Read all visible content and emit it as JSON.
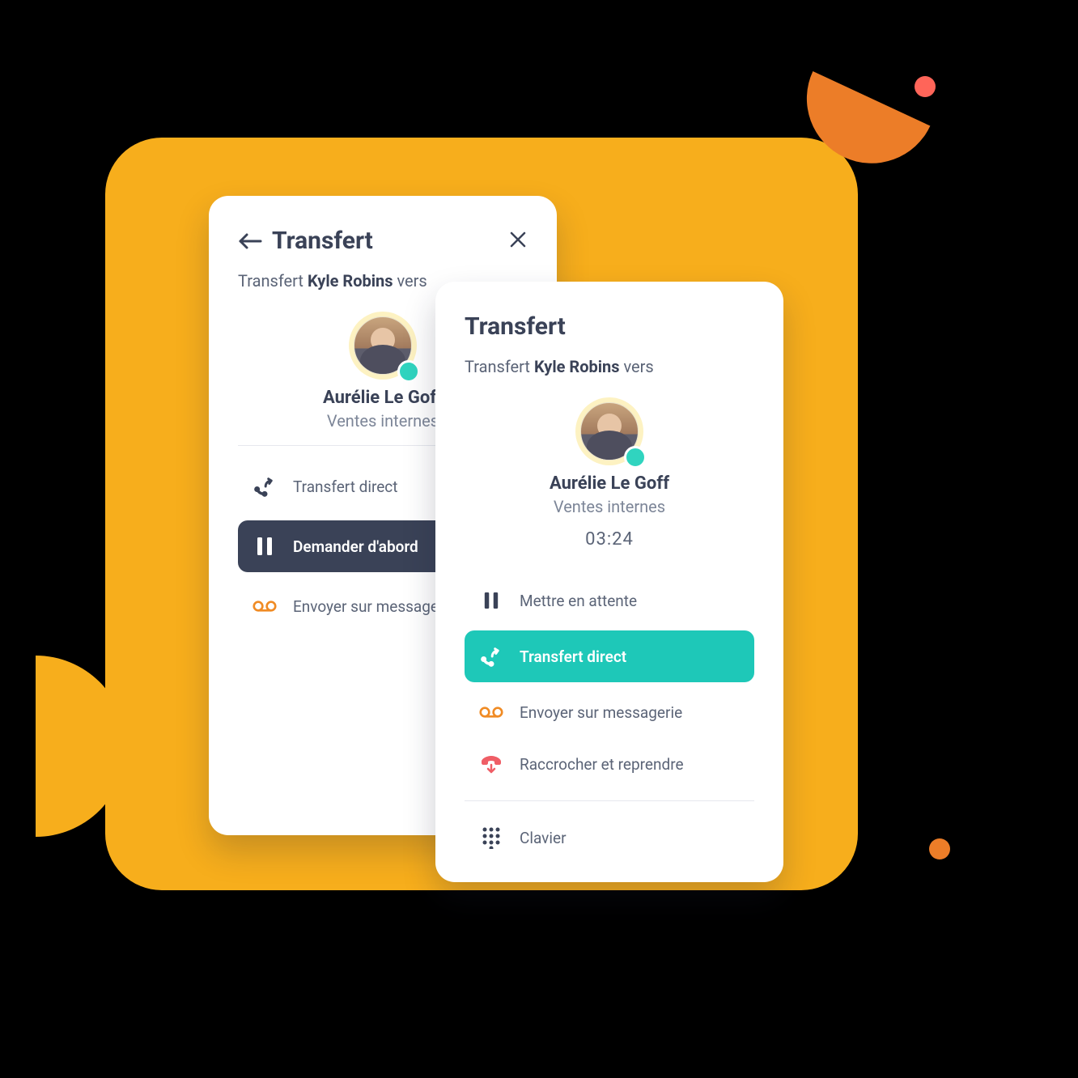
{
  "colors": {
    "ink": "#3a4257",
    "muted": "#7d8698",
    "teal": "#1ec8b8",
    "orange": "#f7ae1c",
    "red": "#ef5e66"
  },
  "contact": {
    "name": "Aurélie Le Goff",
    "role": "Ventes internes",
    "presence": "online"
  },
  "back_panel": {
    "title": "Transfert",
    "sub_prefix": "Transfert ",
    "sub_name": "Kyle Robins",
    "sub_suffix": " vers",
    "options": {
      "direct": "Transfert direct",
      "ask_first": "Demander d'abord",
      "voicemail": "Envoyer sur messagerie"
    }
  },
  "front_panel": {
    "title": "Transfert",
    "sub_prefix": "Transfert ",
    "sub_name": "Kyle Robins",
    "sub_suffix": " vers",
    "timer": "03:24",
    "options": {
      "hold": "Mettre en attente",
      "direct": "Transfert direct",
      "voicemail": "Envoyer sur messagerie",
      "hangup": "Raccrocher et reprendre",
      "keypad": "Clavier"
    }
  }
}
